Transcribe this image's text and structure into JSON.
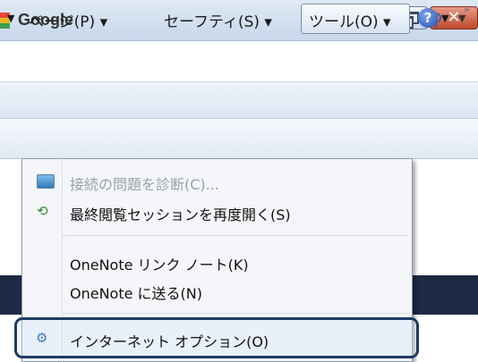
{
  "address_bar": {
    "site_label": "Google"
  },
  "command_bar": {
    "page": "ページ(P) ▾",
    "safety": "セーフティ(S) ▾",
    "tools": "ツール(O) ▾"
  },
  "tools_menu": {
    "items": [
      {
        "label": "接続の問題を診断(C)...",
        "enabled": false
      },
      {
        "label": "最終閲覧セッションを再度開く(S)",
        "enabled": true
      },
      {
        "label": "OneNote リンク ノート(K)",
        "enabled": true
      },
      {
        "label": "OneNote に送る(N)",
        "enabled": true
      },
      {
        "label": "インターネット オプション(O)",
        "enabled": true,
        "highlighted": true
      }
    ]
  },
  "colors": {
    "highlight_border": "#1f3b63",
    "close_button": "#c0492f",
    "banner_dark": "#1e2a44"
  }
}
